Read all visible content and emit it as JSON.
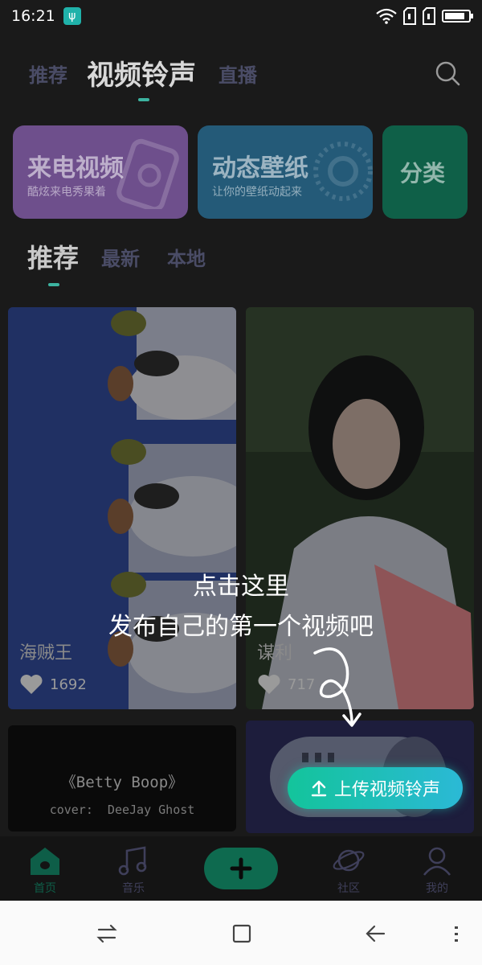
{
  "status_bar": {
    "time": "16:21",
    "usb_icon": "usb-icon",
    "icons": [
      "wifi-icon",
      "sim-1-icon",
      "sim-2-icon",
      "battery-icon"
    ],
    "battery_level": 0.85
  },
  "top_nav": {
    "tabs": [
      {
        "label": "推荐"
      },
      {
        "label": "视频铃声"
      },
      {
        "label": "直播"
      }
    ],
    "active_tab": "视频铃声",
    "search_icon": "search-icon"
  },
  "feature_cards": [
    {
      "title": "来电视频",
      "subtitle": "酷炫来电秀果着",
      "color": "#6e4f8c"
    },
    {
      "title": "动态壁纸",
      "subtitle": "让你的壁纸动起来",
      "color": "#245a78"
    },
    {
      "title": "分类",
      "subtitle": "",
      "color": "#0f6048"
    }
  ],
  "sub_tabs": [
    {
      "label": "推荐"
    },
    {
      "label": "最新"
    },
    {
      "label": "本地"
    }
  ],
  "videos": [
    {
      "name": "海贼王",
      "likes": "1692"
    },
    {
      "name": "谋利",
      "likes": "717"
    },
    {
      "line1": "《Betty Boop》",
      "line2": "cover:  DeeJay Ghost"
    },
    {
      "name": ""
    }
  ],
  "onboarding_hint": {
    "line1": "点击这里",
    "line2": "发布自己的第一个视频吧"
  },
  "upload_button": {
    "label": "上传视频铃声"
  },
  "bottom_nav": [
    {
      "label": "首页",
      "icon": "home-icon"
    },
    {
      "label": "音乐",
      "icon": "music-icon"
    },
    {
      "label": "",
      "icon": "add-icon"
    },
    {
      "label": "社区",
      "icon": "planet-icon"
    },
    {
      "label": "我的",
      "icon": "profile-icon"
    }
  ],
  "system_nav": [
    "switch-icon",
    "square-icon",
    "back-icon",
    "menu-icon"
  ]
}
